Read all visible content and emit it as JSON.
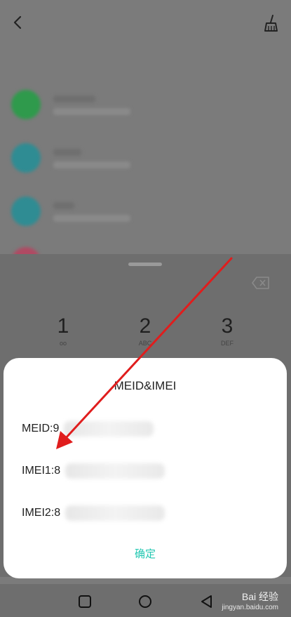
{
  "topbar": {
    "back_icon": "chevron-left-icon",
    "clean_icon": "broom-icon"
  },
  "keypad": {
    "keys": [
      {
        "num": "1",
        "sub": "oo"
      },
      {
        "num": "2",
        "sub": "ABC"
      },
      {
        "num": "3",
        "sub": "DEF"
      }
    ]
  },
  "dialog": {
    "title": "MEID&IMEI",
    "rows": [
      {
        "label": "MEID:9"
      },
      {
        "label": "IMEI1:8"
      },
      {
        "label": "IMEI2:8"
      }
    ],
    "confirm": "确定"
  },
  "watermark": {
    "brand": "Bai 经验",
    "url": "jingyan.baidu.com"
  },
  "colors": {
    "accent": "#22c7b1",
    "arrow": "#e01d1d"
  }
}
